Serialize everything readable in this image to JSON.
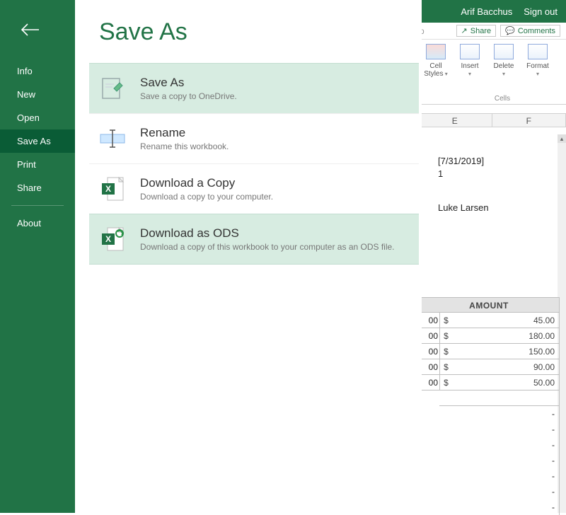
{
  "header": {
    "username": "Arif Bacchus",
    "signout": "Sign out",
    "share_btn": "Share",
    "comments_btn": "Comments"
  },
  "ribbon": {
    "buttons": [
      {
        "label": "Cell\nStyles"
      },
      {
        "label": "Insert"
      },
      {
        "label": "Delete"
      },
      {
        "label": "Format"
      }
    ],
    "group_label": "Cells"
  },
  "columns": [
    "E",
    "F"
  ],
  "sheet": {
    "date": "[7/31/2019]",
    "num": "1",
    "name": "Luke Larsen"
  },
  "amount": {
    "header": "AMOUNT",
    "rows": [
      {
        "left": "00",
        "cur": "$",
        "val": "45.00"
      },
      {
        "left": "00",
        "cur": "$",
        "val": "180.00"
      },
      {
        "left": "00",
        "cur": "$",
        "val": "150.00"
      },
      {
        "left": "00",
        "cur": "$",
        "val": "90.00"
      },
      {
        "left": "00",
        "cur": "$",
        "val": "50.00"
      }
    ],
    "dashes": [
      "-",
      "-",
      "-",
      "-",
      "-",
      "-",
      "-"
    ]
  },
  "sidebar": {
    "items": [
      {
        "label": "Info"
      },
      {
        "label": "New"
      },
      {
        "label": "Open"
      },
      {
        "label": "Save As"
      },
      {
        "label": "Print"
      },
      {
        "label": "Share"
      },
      {
        "label": "About"
      }
    ],
    "active_index": 3
  },
  "panel": {
    "title": "Save As",
    "options": [
      {
        "title": "Save As",
        "desc": "Save a copy to OneDrive.",
        "highlight": true,
        "icon": "saveas"
      },
      {
        "title": "Rename",
        "desc": "Rename this workbook.",
        "highlight": false,
        "icon": "rename"
      },
      {
        "title": "Download a Copy",
        "desc": "Download a copy to your computer.",
        "highlight": false,
        "icon": "xlsx"
      },
      {
        "title": "Download as ODS",
        "desc": "Download a copy of this workbook to your computer as an ODS file.",
        "highlight": true,
        "icon": "ods"
      }
    ]
  }
}
